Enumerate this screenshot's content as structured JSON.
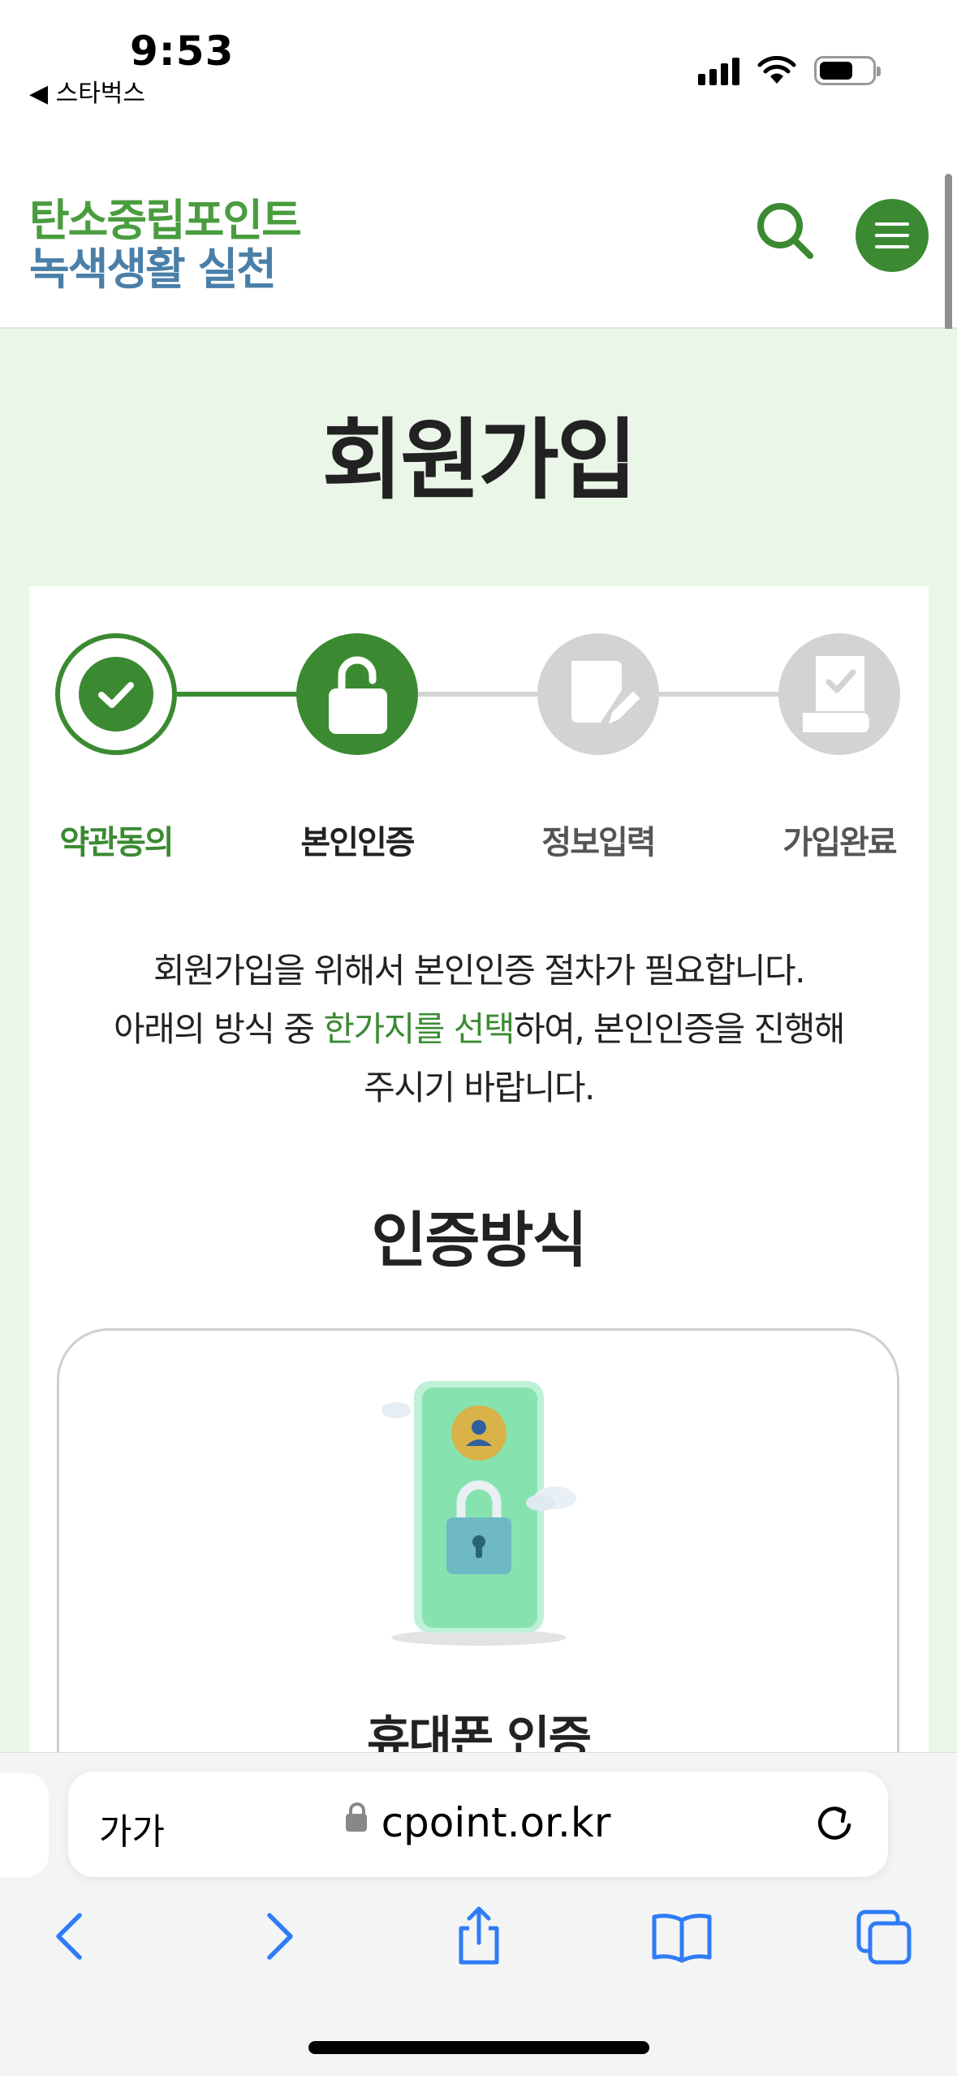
{
  "status_bar": {
    "time": "9:53",
    "back_label": "◀ 스타벅스"
  },
  "header": {
    "logo_line1": "탄소중립포인트",
    "logo_line2": "녹색생활 실천"
  },
  "page": {
    "title": "회원가입"
  },
  "steps": [
    {
      "label": "약관동의",
      "state": "done"
    },
    {
      "label": "본인인증",
      "state": "current"
    },
    {
      "label": "정보입력",
      "state": "todo"
    },
    {
      "label": "가입완료",
      "state": "todo"
    }
  ],
  "description": {
    "line1": "회원가입을 위해서 본인인증 절차가 필요합니다.",
    "line2_pre": "아래의 방식 중 ",
    "line2_highlight": "한가지를 선택",
    "line2_post": "하여, 본인인증을 진행해",
    "line3": "주시기 바랍니다."
  },
  "section": {
    "title": "인증방식"
  },
  "auth_methods": [
    {
      "label": "휴대폰 인증"
    }
  ],
  "browser": {
    "text_size_button": "가가",
    "url": "cpoint.or.kr"
  },
  "colors": {
    "primary_green": "#3b8a32",
    "logo_green": "#4a9d3e",
    "logo_blue": "#4a7fa8",
    "bg_green": "#eaf6e8",
    "step_inactive": "#d3d3d3",
    "safari_blue": "#2f7cf6"
  }
}
